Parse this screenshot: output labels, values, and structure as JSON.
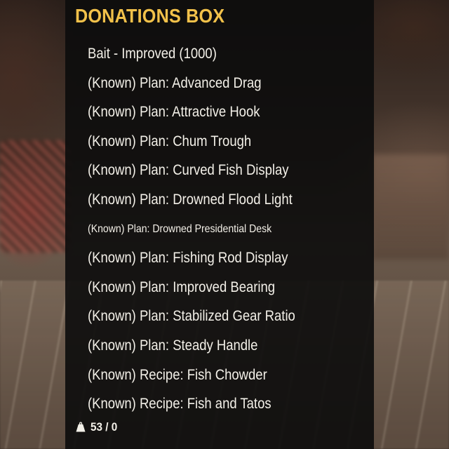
{
  "panel": {
    "title": "DONATIONS BOX",
    "items": [
      {
        "label": "Bait - Improved (1000)"
      },
      {
        "label": "(Known)  Plan: Advanced Drag"
      },
      {
        "label": "(Known)  Plan: Attractive Hook"
      },
      {
        "label": "(Known)  Plan: Chum Trough"
      },
      {
        "label": "(Known)  Plan: Curved Fish Display"
      },
      {
        "label": "(Known)  Plan: Drowned Flood Light"
      },
      {
        "label": "(Known)  Plan: Drowned Presidential Desk"
      },
      {
        "label": "(Known)  Plan: Fishing Rod Display"
      },
      {
        "label": "(Known)  Plan: Improved Bearing"
      },
      {
        "label": "(Known)  Plan: Stabilized Gear Ratio"
      },
      {
        "label": "(Known)  Plan: Steady Handle"
      },
      {
        "label": "(Known)  Recipe: Fish Chowder"
      },
      {
        "label": "(Known)  Recipe: Fish and Tatos"
      }
    ]
  },
  "footer": {
    "icon": "weight-icon",
    "weight": "53 / 0"
  },
  "colors": {
    "title": "#f2c14a",
    "text": "#f3f0e8",
    "panel_bg": "#0c0c0c"
  }
}
